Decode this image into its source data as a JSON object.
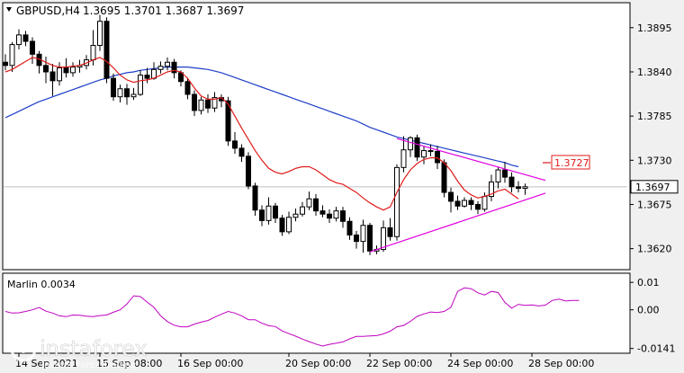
{
  "colors": {
    "background": "#ffffff",
    "frame": "#000000",
    "bull_candle": "#ffffff",
    "bear_candle": "#000000",
    "ma_fast": "#e01b1b",
    "ma_slow": "#1f3fc8",
    "triangle": "#e000e0",
    "indicator": "#c000c0",
    "current_price_line": "#c0c0c0",
    "resistance_label": "#e01b1b",
    "watermark": "#ffffff"
  },
  "header": {
    "symbol_tf": "GBPUSD,H4",
    "ohlc": "1.3695 1.3701 1.3687 1.3697"
  },
  "indicator": {
    "label": "Marlin 0.0034",
    "axis_ticks": [
      "0.01",
      "0.00",
      "-0.0141"
    ],
    "axis_values": [
      0.01,
      0.0,
      -0.0141
    ],
    "range": [
      -0.0155,
      0.013
    ],
    "values": [
      -0.0006,
      -0.0012,
      -0.0011,
      -0.0006,
      0.0,
      0.0008,
      -0.0005,
      -0.0012,
      -0.0022,
      -0.0025,
      -0.0019,
      -0.002,
      -0.0023,
      -0.0025,
      -0.0021,
      -0.0019,
      -0.0009,
      0.0,
      0.0021,
      0.0051,
      0.0048,
      0.0028,
      0.0009,
      -0.0022,
      -0.0043,
      -0.0056,
      -0.0062,
      -0.0062,
      -0.0052,
      -0.0045,
      -0.0039,
      -0.0027,
      -0.0016,
      -0.0006,
      -0.0012,
      -0.0022,
      -0.0036,
      -0.0036,
      -0.0049,
      -0.0058,
      -0.0061,
      -0.0077,
      -0.0087,
      -0.0096,
      -0.0107,
      -0.0116,
      -0.0125,
      -0.0132,
      -0.0126,
      -0.0122,
      -0.0117,
      -0.0106,
      -0.0097,
      -0.0097,
      -0.0095,
      -0.0094,
      -0.0088,
      -0.0078,
      -0.0062,
      -0.0057,
      -0.0042,
      -0.0024,
      -0.0015,
      -0.0008,
      -0.001,
      -0.0006,
      0.0009,
      0.0067,
      0.008,
      0.0077,
      0.0062,
      0.0054,
      0.0067,
      0.0063,
      0.0027,
      0.0006,
      0.002,
      0.0016,
      0.0018,
      0.0014,
      0.0017,
      0.0034,
      0.0039,
      0.0032,
      0.0034,
      0.0034
    ]
  },
  "watermark": {
    "brand": "instaforex",
    "tagline": "Instant Forex Trading"
  },
  "chart_data": {
    "type": "candlestick",
    "symbol": "GBPUSD",
    "timeframe": "H4",
    "ylim": [
      1.3595,
      1.3925
    ],
    "y_ticks": [
      "1.3895",
      "1.3840",
      "1.3785",
      "1.3730",
      "1.3675",
      "1.3620"
    ],
    "y_tick_values": [
      1.3895,
      1.384,
      1.3785,
      1.373,
      1.3675,
      1.362
    ],
    "x_labels": [
      {
        "text": "14 Sep 2021",
        "bar": 2
      },
      {
        "text": "15 Sep 08:00",
        "bar": 14
      },
      {
        "text": "16 Sep 00:00",
        "bar": 26
      },
      {
        "text": "20 Sep 00:00",
        "bar": 42
      },
      {
        "text": "22 Sep 00:00",
        "bar": 54
      },
      {
        "text": "24 Sep 00:00",
        "bar": 66
      },
      {
        "text": "28 Sep 00:00",
        "bar": 78
      }
    ],
    "candles": [
      [
        1.3852,
        1.3848,
        1.3862,
        1.3842
      ],
      [
        1.3848,
        1.3874,
        1.3877,
        1.384
      ],
      [
        1.3874,
        1.3886,
        1.3893,
        1.3868
      ],
      [
        1.3886,
        1.3878,
        1.3891,
        1.3872
      ],
      [
        1.3878,
        1.3862,
        1.3883,
        1.385
      ],
      [
        1.3862,
        1.3848,
        1.3866,
        1.3838
      ],
      [
        1.3848,
        1.384,
        1.3859,
        1.3826
      ],
      [
        1.384,
        1.3829,
        1.385,
        1.381
      ],
      [
        1.3829,
        1.3845,
        1.3852,
        1.3823
      ],
      [
        1.3845,
        1.3839,
        1.3857,
        1.3833
      ],
      [
        1.3839,
        1.3846,
        1.3852,
        1.3834
      ],
      [
        1.3846,
        1.3848,
        1.3855,
        1.3839
      ],
      [
        1.3848,
        1.3855,
        1.3861,
        1.3843
      ],
      [
        1.3855,
        1.3873,
        1.3892,
        1.3848
      ],
      [
        1.3873,
        1.3903,
        1.3911,
        1.3866
      ],
      [
        1.3903,
        1.3832,
        1.3908,
        1.3826
      ],
      [
        1.3832,
        1.3809,
        1.3838,
        1.3804
      ],
      [
        1.3809,
        1.3819,
        1.3824,
        1.3802
      ],
      [
        1.3819,
        1.3809,
        1.3825,
        1.3799
      ],
      [
        1.3809,
        1.3812,
        1.382,
        1.3805
      ],
      [
        1.3812,
        1.3836,
        1.3842,
        1.381
      ],
      [
        1.3836,
        1.3832,
        1.3845,
        1.3826
      ],
      [
        1.3832,
        1.3843,
        1.3852,
        1.383
      ],
      [
        1.3843,
        1.3847,
        1.3853,
        1.3838
      ],
      [
        1.3847,
        1.3852,
        1.3858,
        1.3842
      ],
      [
        1.3852,
        1.3839,
        1.3856,
        1.3832
      ],
      [
        1.3839,
        1.3828,
        1.3842,
        1.3822
      ],
      [
        1.3828,
        1.3812,
        1.3833,
        1.3806
      ],
      [
        1.3812,
        1.3792,
        1.3817,
        1.3785
      ],
      [
        1.3792,
        1.3805,
        1.3809,
        1.3787
      ],
      [
        1.3805,
        1.3795,
        1.3812,
        1.3789
      ],
      [
        1.3795,
        1.3808,
        1.3815,
        1.379
      ],
      [
        1.3808,
        1.3804,
        1.3812,
        1.3796
      ],
      [
        1.3804,
        1.3754,
        1.3809,
        1.3748
      ],
      [
        1.3754,
        1.3745,
        1.3765,
        1.3738
      ],
      [
        1.3745,
        1.3735,
        1.375,
        1.3728
      ],
      [
        1.3735,
        1.3698,
        1.374,
        1.3694
      ],
      [
        1.3698,
        1.3668,
        1.3702,
        1.3661
      ],
      [
        1.3668,
        1.3655,
        1.3674,
        1.3648
      ],
      [
        1.3655,
        1.3673,
        1.3684,
        1.365
      ],
      [
        1.3673,
        1.3658,
        1.3677,
        1.3652
      ],
      [
        1.3658,
        1.3641,
        1.3662,
        1.3636
      ],
      [
        1.3641,
        1.3659,
        1.3666,
        1.3638
      ],
      [
        1.3659,
        1.3663,
        1.367,
        1.3654
      ],
      [
        1.3663,
        1.3672,
        1.3678,
        1.366
      ],
      [
        1.3672,
        1.3682,
        1.3691,
        1.3668
      ],
      [
        1.3682,
        1.3667,
        1.3688,
        1.3661
      ],
      [
        1.3667,
        1.3663,
        1.3674,
        1.3659
      ],
      [
        1.3663,
        1.3658,
        1.3669,
        1.3652
      ],
      [
        1.3658,
        1.3667,
        1.3672,
        1.3654
      ],
      [
        1.3667,
        1.3654,
        1.3672,
        1.3646
      ],
      [
        1.3654,
        1.3637,
        1.3659,
        1.3631
      ],
      [
        1.3637,
        1.3629,
        1.3642,
        1.362
      ],
      [
        1.3629,
        1.3649,
        1.3656,
        1.3615
      ],
      [
        1.3649,
        1.3617,
        1.3652,
        1.3612
      ],
      [
        1.3617,
        1.3619,
        1.3624,
        1.3613
      ],
      [
        1.3619,
        1.3646,
        1.3655,
        1.3616
      ],
      [
        1.3646,
        1.3635,
        1.3658,
        1.363
      ],
      [
        1.3635,
        1.3721,
        1.3725,
        1.363
      ],
      [
        1.3721,
        1.3743,
        1.376,
        1.3715
      ],
      [
        1.3743,
        1.3758,
        1.376,
        1.3734
      ],
      [
        1.3758,
        1.3734,
        1.3762,
        1.3729
      ],
      [
        1.3734,
        1.3742,
        1.3748,
        1.3725
      ],
      [
        1.3742,
        1.3741,
        1.375,
        1.3735
      ],
      [
        1.3741,
        1.3727,
        1.3748,
        1.3719
      ],
      [
        1.3727,
        1.369,
        1.3731,
        1.3684
      ],
      [
        1.369,
        1.3679,
        1.3696,
        1.3665
      ],
      [
        1.3679,
        1.3673,
        1.3686,
        1.3668
      ],
      [
        1.3673,
        1.368,
        1.3684,
        1.3671
      ],
      [
        1.368,
        1.3675,
        1.3684,
        1.3668
      ],
      [
        1.3675,
        1.3669,
        1.3679,
        1.3663
      ],
      [
        1.3669,
        1.3685,
        1.369,
        1.3666
      ],
      [
        1.3685,
        1.3703,
        1.3712,
        1.3679
      ],
      [
        1.3703,
        1.3718,
        1.3722,
        1.3695
      ],
      [
        1.3718,
        1.3709,
        1.3728,
        1.3702
      ],
      [
        1.3709,
        1.3697,
        1.3715,
        1.369
      ],
      [
        1.3697,
        1.3695,
        1.3704,
        1.369
      ],
      [
        1.3695,
        1.3697,
        1.3701,
        1.3687
      ]
    ],
    "ma_fast": [
      1.384,
      1.3843,
      1.3848,
      1.3853,
      1.3858,
      1.3856,
      1.3852,
      1.3848,
      1.3846,
      1.3846,
      1.3847,
      1.3848,
      1.3851,
      1.3855,
      1.3858,
      1.3853,
      1.3845,
      1.3836,
      1.383,
      1.3827,
      1.3829,
      1.383,
      1.3832,
      1.3836,
      1.384,
      1.3842,
      1.384,
      1.3832,
      1.382,
      1.381,
      1.3806,
      1.3806,
      1.3808,
      1.38,
      1.3785,
      1.377,
      1.3756,
      1.3742,
      1.373,
      1.372,
      1.3715,
      1.3713,
      1.3716,
      1.372,
      1.3722,
      1.3722,
      1.3718,
      1.3712,
      1.3706,
      1.3702,
      1.37,
      1.3695,
      1.369,
      1.3683,
      1.3677,
      1.3672,
      1.3668,
      1.3672,
      1.369,
      1.3706,
      1.3718,
      1.3726,
      1.3731,
      1.3733,
      1.3733,
      1.3727,
      1.3717,
      1.3704,
      1.3693,
      1.3687,
      1.3683,
      1.3685,
      1.3688,
      1.3692,
      1.3694,
      1.3688,
      1.3682
    ],
    "ma_slow": [
      1.3783,
      1.3787,
      1.3791,
      1.3795,
      1.3799,
      1.3803,
      1.3806,
      1.3809,
      1.3812,
      1.3815,
      1.3818,
      1.3821,
      1.3824,
      1.3827,
      1.383,
      1.3832,
      1.3835,
      1.3837,
      1.3839,
      1.384,
      1.3842,
      1.3843,
      1.3844,
      1.3845,
      1.3846,
      1.3846,
      1.3846,
      1.3846,
      1.3845,
      1.3844,
      1.3843,
      1.3841,
      1.3839,
      1.3836,
      1.3833,
      1.383,
      1.3827,
      1.3824,
      1.3821,
      1.3818,
      1.3815,
      1.3812,
      1.3809,
      1.3806,
      1.3803,
      1.38,
      1.3797,
      1.3794,
      1.3791,
      1.3788,
      1.3785,
      1.3782,
      1.3779,
      1.3775,
      1.3771,
      1.3768,
      1.3765,
      1.3762,
      1.3759,
      1.3757,
      1.3755,
      1.3753,
      1.3751,
      1.3749,
      1.3747,
      1.3745,
      1.3743,
      1.3741,
      1.3739,
      1.3737,
      1.3735,
      1.3733,
      1.3731,
      1.3729,
      1.3727,
      1.3724,
      1.3722
    ],
    "triangle_upper": {
      "from_bar": 58,
      "from": 1.3757,
      "to_bar": 80,
      "to": 1.3705
    },
    "triangle_lower": {
      "from_bar": 54,
      "from": 1.3616,
      "to_bar": 80,
      "to": 1.3689
    },
    "resistance_label": "1.3727",
    "resistance_value": 1.3727,
    "current_price": 1.3697,
    "current_price_label": "1.3697"
  }
}
